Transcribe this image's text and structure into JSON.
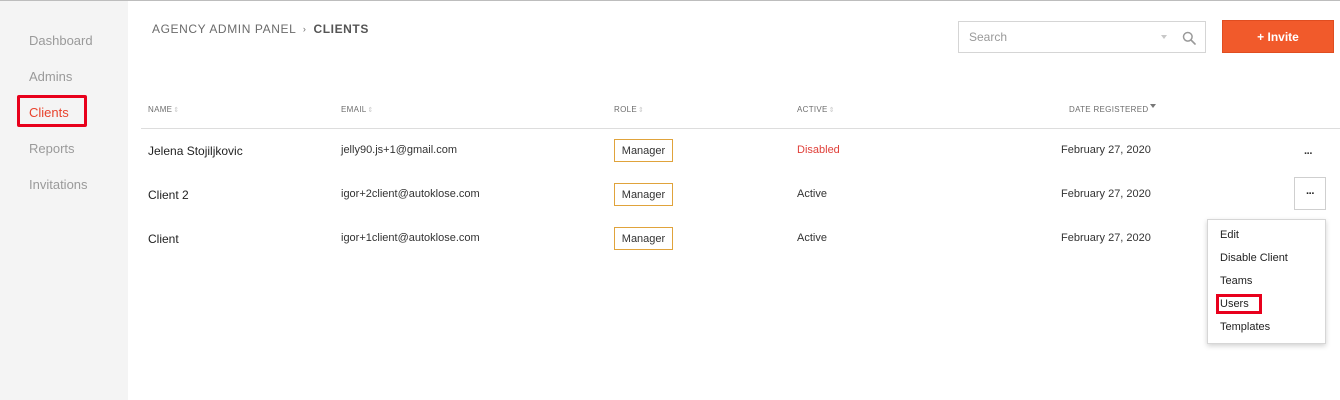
{
  "sidebar": {
    "items": [
      {
        "label": "Dashboard"
      },
      {
        "label": "Admins"
      },
      {
        "label": "Clients"
      },
      {
        "label": "Reports"
      },
      {
        "label": "Invitations"
      }
    ],
    "active_item": "Clients"
  },
  "header": {
    "breadcrumb_parent": "AGENCY ADMIN PANEL",
    "breadcrumb_separator": "›",
    "breadcrumb_current": "CLIENTS",
    "search_placeholder": "Search",
    "invite_label": "+ Invite"
  },
  "table": {
    "columns": {
      "name": "NAME",
      "email": "EMAIL",
      "role": "ROLE",
      "active": "ACTIVE",
      "date_registered": "DATE REGISTERED"
    },
    "rows": [
      {
        "name": "Jelena Stojiljkovic",
        "email": "jelly90.js+1@gmail.com",
        "role": "Manager",
        "status": "Disabled",
        "date": "February 27, 2020",
        "actions": "···"
      },
      {
        "name": "Client 2",
        "email": "igor+2client@autoklose.com",
        "role": "Manager",
        "status": "Active",
        "date": "February 27, 2020",
        "actions": "···"
      },
      {
        "name": "Client",
        "email": "igor+1client@autoklose.com",
        "role": "Manager",
        "status": "Active",
        "date": "February 27, 2020",
        "actions": ""
      }
    ]
  },
  "action_menu": {
    "items": [
      "Edit",
      "Disable Client",
      "Teams",
      "Users",
      "Templates"
    ],
    "highlighted": "Users"
  },
  "colors": {
    "accent": "#f15a2b",
    "active_nav": "#e8432d",
    "disabled_status": "#e0403a",
    "role_badge_border": "#e0a33b",
    "highlight_box": "#e8001c"
  },
  "icons": {
    "search": "magnifier-icon",
    "dropdown": "caret-down-icon",
    "sort": "sort-arrows-icon",
    "actions": "more-dots-icon"
  }
}
